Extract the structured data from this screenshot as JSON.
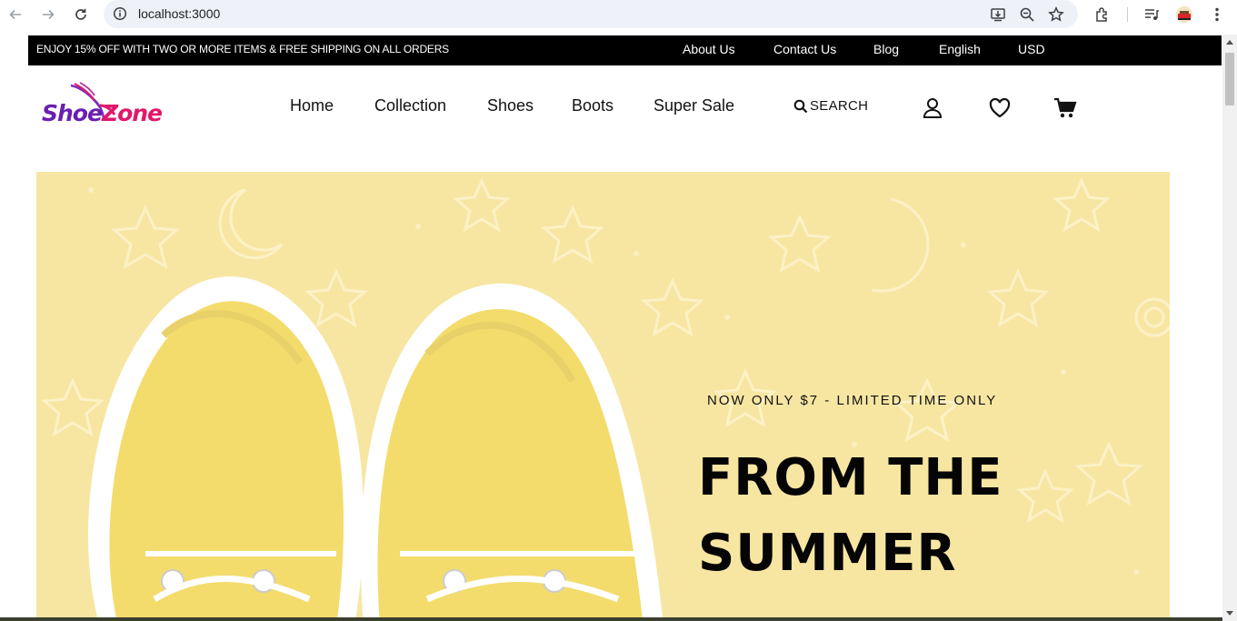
{
  "browser": {
    "url": "localhost:3000"
  },
  "announcement": {
    "promo": "ENJOY 15% OFF WITH TWO OR MORE ITEMS & FREE SHIPPING ON ALL ORDERS",
    "links": [
      "About Us",
      "Contact Us",
      "Blog",
      "English",
      "USD"
    ]
  },
  "header": {
    "logo": {
      "part1": "Shoe",
      "part2": "Zone"
    },
    "nav": [
      "Home",
      "Collection",
      "Shoes",
      "Boots",
      "Super Sale"
    ],
    "search_label": "SEARCH",
    "icons": [
      "search-icon",
      "user-icon",
      "heart-icon",
      "cart-icon"
    ]
  },
  "hero": {
    "kicker": "NOW ONLY $7 - LIMITED TIME ONLY",
    "headline_line1": "FROM THE",
    "headline_line2": "SUMMER"
  },
  "colors": {
    "topbar_bg": "#000000",
    "hero_bg": "#f7e6a2",
    "shoe": "#f3dc6c",
    "logo_purple": "#6a1fb0",
    "logo_pink": "#e0186b"
  }
}
